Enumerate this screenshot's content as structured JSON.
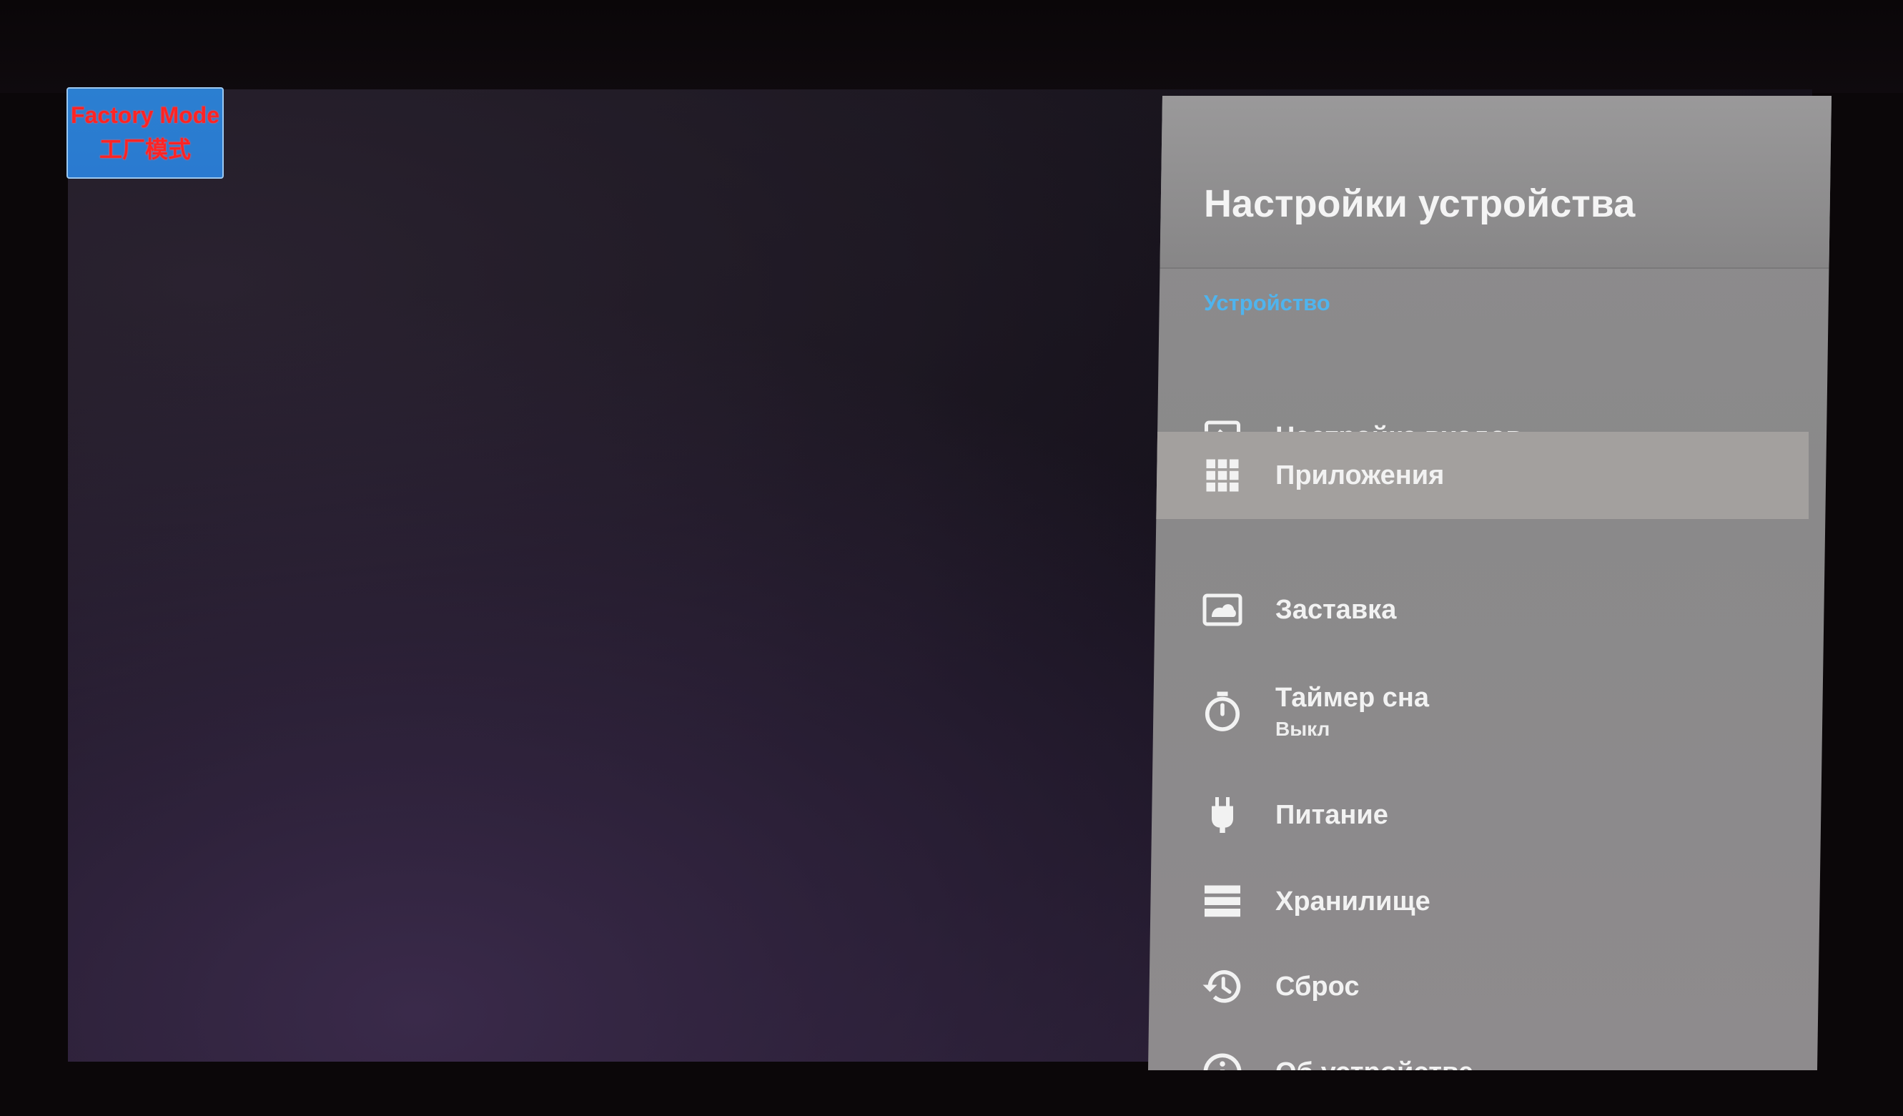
{
  "factory_badge": {
    "line1": "Factory Mode",
    "line2": "工厂模式",
    "background": "#2b7fd1",
    "text_color": "#ff2424"
  },
  "panel": {
    "title": "Настройки устройства",
    "section": "Устройство",
    "accent_color": "#4fb4ee",
    "items": [
      {
        "label": "Настройка входов",
        "sub": "",
        "icon": "input-icon",
        "selected": false
      },
      {
        "label": "Приложения",
        "sub": "",
        "icon": "apps-grid-icon",
        "selected": true
      },
      {
        "label": "Заставка",
        "sub": "",
        "icon": "screensaver-icon",
        "selected": false
      },
      {
        "label": "Таймер сна",
        "sub": "Выкл",
        "icon": "timer-icon",
        "selected": false
      },
      {
        "label": "Питание",
        "sub": "",
        "icon": "power-plug-icon",
        "selected": false
      },
      {
        "label": "Хранилище",
        "sub": "",
        "icon": "storage-icon",
        "selected": false
      },
      {
        "label": "Сброс",
        "sub": "",
        "icon": "reset-history-icon",
        "selected": false
      },
      {
        "label": "Об устройстве",
        "sub": "",
        "icon": "info-icon",
        "selected": false
      }
    ]
  }
}
